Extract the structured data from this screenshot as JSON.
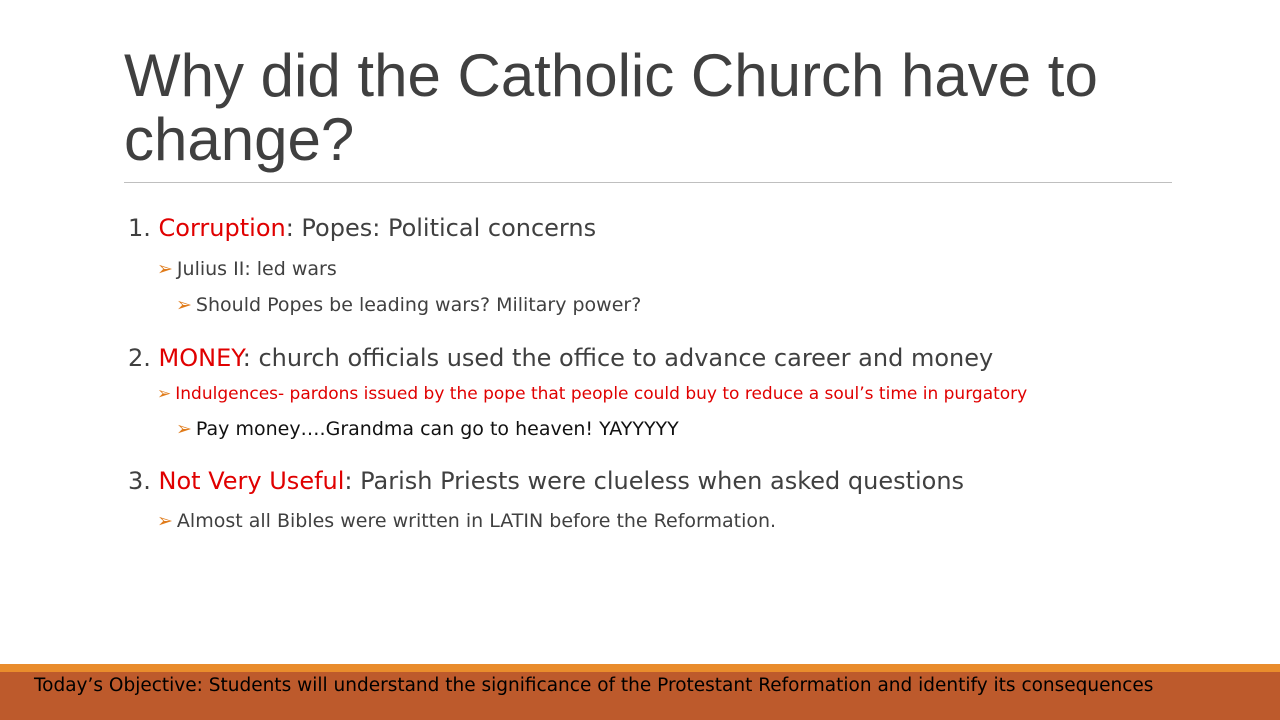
{
  "slide": {
    "title": "Why did the Catholic Church have to change?",
    "points": [
      {
        "number": "1.",
        "keyword": "Corruption",
        "rest": ": Popes: Political concerns",
        "sub": {
          "text": "Julius II: led wars",
          "subsub": "Should Popes be leading wars? Military power?"
        }
      },
      {
        "number": "2.",
        "keyword": "MONEY",
        "rest": ": church officials used the office to advance career and money",
        "sub": {
          "text": "Indulgences- pardons issued by the pope that people could buy to reduce a soul’s time in purgatory",
          "subsub": "Pay money….Grandma can go to heaven! YAYYYYY"
        }
      },
      {
        "number": "3.",
        "keyword": "Not Very Useful",
        "rest": ": Parish Priests were clueless when asked questions",
        "sub": {
          "text": "Almost all Bibles were written in LATIN before the Reformation."
        }
      }
    ],
    "bullet_glyph": "➢"
  },
  "footer": {
    "objective": "Today’s Objective: Students will understand the significance of the Protestant Reformation and identify its consequences"
  },
  "colors": {
    "title": "#404040",
    "keyword": "#e00000",
    "bullet": "#e07b1a",
    "footer_bar": "#bd5a2c",
    "footer_accent": "#e98c2c"
  }
}
